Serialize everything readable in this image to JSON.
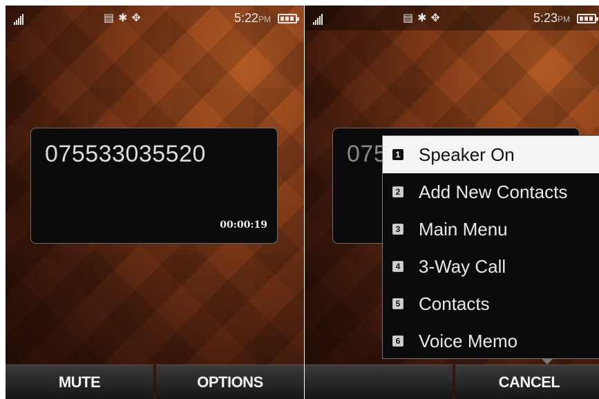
{
  "left": {
    "status": {
      "time": "5:22",
      "ampm": "PM"
    },
    "call": {
      "number": "075533035520",
      "timer": "00:00:19"
    },
    "softkeys": {
      "left": "MUTE",
      "right": "OPTIONS"
    }
  },
  "right": {
    "status": {
      "time": "5:23",
      "ampm": "PM"
    },
    "call": {
      "number": "075"
    },
    "menu": {
      "items": [
        {
          "index": "1",
          "label": "Speaker On"
        },
        {
          "index": "2",
          "label": "Add New Contacts"
        },
        {
          "index": "3",
          "label": "Main Menu"
        },
        {
          "index": "4",
          "label": "3-Way Call"
        },
        {
          "index": "5",
          "label": "Contacts"
        },
        {
          "index": "6",
          "label": "Voice Memo"
        }
      ],
      "selected_index": 0
    },
    "softkeys": {
      "left": "",
      "right": "CANCEL"
    }
  },
  "icons": {
    "signal": "signal-icon",
    "vibrate": "vibrate-icon",
    "bluetooth": "bluetooth-icon",
    "location": "location-icon",
    "battery": "battery-icon"
  }
}
